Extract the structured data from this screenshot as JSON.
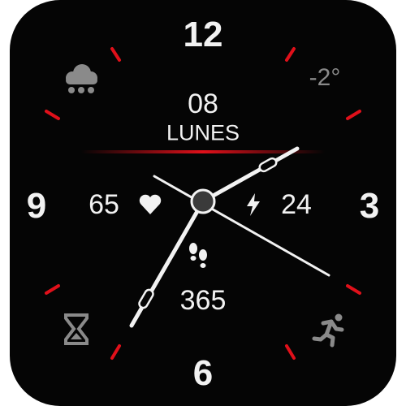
{
  "dial": {
    "n12": "12",
    "n3": "3",
    "n6": "6",
    "n9": "9"
  },
  "date": {
    "day": "08",
    "weekday": "LUNES"
  },
  "weather": {
    "icon": "snow-cloud-icon",
    "temperature": "-2°"
  },
  "heart_rate": {
    "icon": "heart-icon",
    "value": "65"
  },
  "battery": {
    "icon": "lightning-icon",
    "value": "24"
  },
  "steps": {
    "icon": "footprints-icon",
    "value": "365"
  },
  "complications": {
    "bottom_left": "hourglass-icon",
    "bottom_right": "running-icon"
  },
  "time": {
    "hour": 1,
    "minute": 35,
    "second": 19
  },
  "colors": {
    "accent": "#e0101a",
    "background": "#050505",
    "text": "#f2f2f2",
    "muted": "#8a8a8a"
  }
}
